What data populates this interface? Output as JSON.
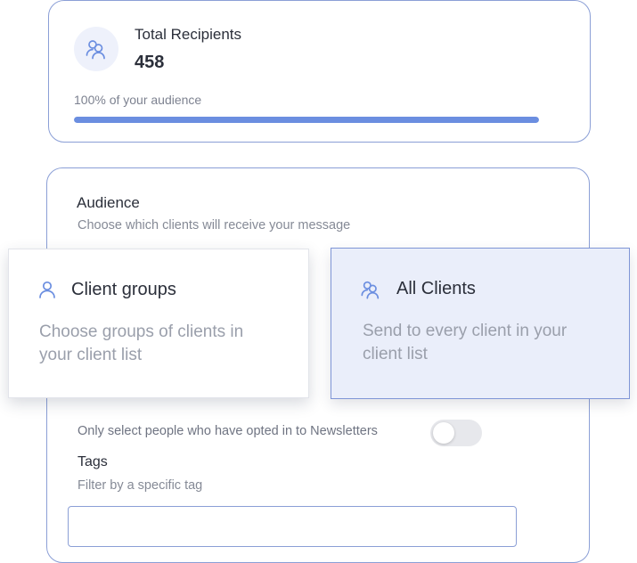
{
  "summary": {
    "icon": "users-icon",
    "title": "Total Recipients",
    "count": "458",
    "audience_text": "100% of your audience",
    "audience_fraction": 1.0
  },
  "audience": {
    "heading": "Audience",
    "subheading": "Choose which clients will receive your message",
    "options": [
      {
        "icon": "user-icon",
        "title": "Client groups",
        "description_line1": "Choose groups of clients in",
        "description_line2": "your client list",
        "selected": false
      },
      {
        "icon": "users-icon",
        "title": "All Clients",
        "description_line1": "Send to every client in your",
        "description_line2": "client list",
        "selected": true
      }
    ],
    "newsletter_label": "Only select people who have opted in to Newsletters",
    "newsletter_toggle_on": false
  },
  "tags": {
    "heading": "Tags",
    "subheading": "Filter by a specific tag",
    "input_value": ""
  },
  "colors": {
    "accent": "#6b8ee0",
    "border": "#8b9fd6",
    "selected_bg": "#eaeefa"
  }
}
